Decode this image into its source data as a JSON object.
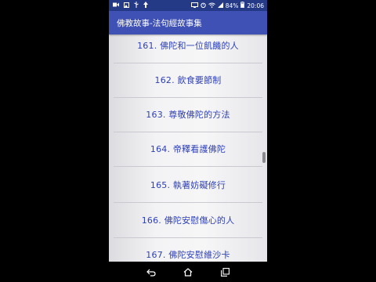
{
  "status_bar": {
    "battery": "84%",
    "time": "20:06"
  },
  "app_bar": {
    "title": "佛教故事-法句經故事集"
  },
  "list": {
    "items": [
      {
        "label": "161. 佛陀和一位飢饑的人"
      },
      {
        "label": "162. 飲食要節制"
      },
      {
        "label": "163. 尊敬佛陀的方法"
      },
      {
        "label": "164. 帝釋看護佛陀"
      },
      {
        "label": "165. 執著妨礙修行"
      },
      {
        "label": "166. 佛陀安慰傷心的人"
      },
      {
        "label": "167. 佛陀安慰維沙卡"
      }
    ]
  },
  "colors": {
    "status_bar": "#243a86",
    "app_bar": "#3f51b5",
    "item_text": "#2d3fb8"
  },
  "icons": {
    "status_left": [
      "video-icon",
      "image-icon",
      "usb-icon",
      "upload-icon"
    ],
    "status_right": [
      "cast-icon",
      "alarm-icon",
      "wifi-icon",
      "signal-icon",
      "battery-icon"
    ],
    "nav": [
      "back-icon",
      "home-icon",
      "recents-icon"
    ]
  }
}
